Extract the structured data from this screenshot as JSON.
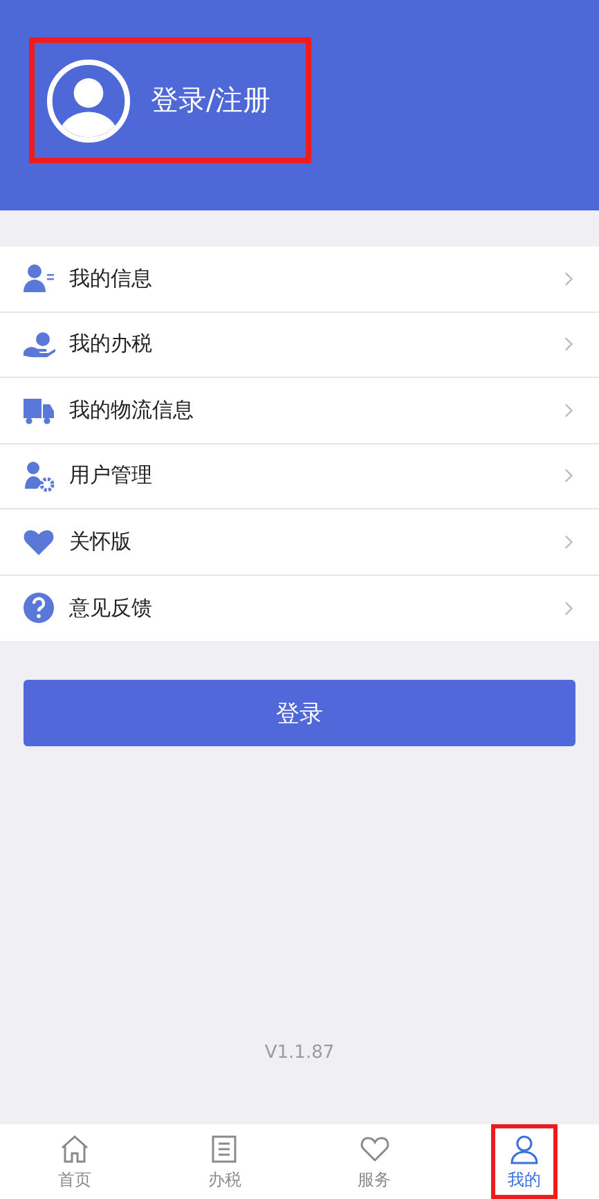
{
  "profile": {
    "label": "登录/注册",
    "highlighted": true
  },
  "menu": [
    {
      "label": "我的信息"
    },
    {
      "label": "我的办税"
    },
    {
      "label": "我的物流信息"
    },
    {
      "label": "用户管理"
    },
    {
      "label": "关怀版"
    },
    {
      "label": "意见反馈"
    }
  ],
  "login_button": "登录",
  "version": "V1.1.87",
  "tabs": [
    {
      "label": "首页",
      "selected": false,
      "highlighted": false
    },
    {
      "label": "办税",
      "selected": false,
      "highlighted": false
    },
    {
      "label": "服务",
      "selected": false,
      "highlighted": false
    },
    {
      "label": "我的",
      "selected": true,
      "highlighted": true
    }
  ]
}
